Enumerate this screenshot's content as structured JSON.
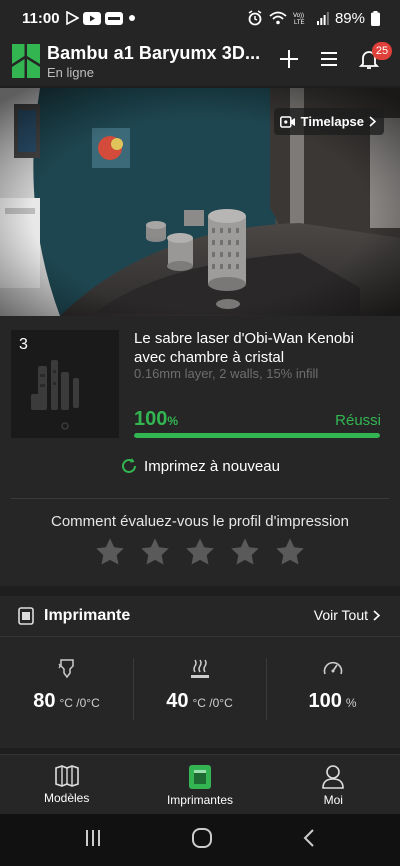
{
  "status_bar": {
    "time": "11:00",
    "app_icons": [
      "play-store-icon",
      "youtube-icon",
      "bbc-app-icon",
      "dot-icon"
    ],
    "status_icons": [
      "alarm-icon",
      "wifi-icon",
      "volte-lte-icon",
      "signal-icon"
    ],
    "volte": "VoLTE",
    "battery": "89%"
  },
  "header": {
    "title": "Bambu a1 Baryumx 3D...",
    "status": "En ligne",
    "notification_count": "25",
    "brand_color": "#33b652"
  },
  "camera": {
    "timelapse_label": "Timelapse"
  },
  "job": {
    "plate_number": "3",
    "name": "Le sabre laser d'Obi-Wan Kenobi avec chambre à cristal",
    "meta": "0.16mm layer, 2 walls, 15% infill",
    "progress_value": "100",
    "progress_unit": "%",
    "progress_fraction": 1.0,
    "state": "Réussi",
    "reprint_label": "Imprimez à nouveau",
    "rating_title": "Comment évaluez-vous le profil d'impression",
    "rating_stars": 5,
    "rating_value": 0
  },
  "printer": {
    "title": "Imprimante",
    "see_all": "Voir Tout",
    "stats": [
      {
        "icon": "nozzle-icon",
        "value": "80",
        "unit": "°C /0°C"
      },
      {
        "icon": "heatbed-icon",
        "value": "40",
        "unit": "°C /0°C"
      },
      {
        "icon": "speed-gauge-icon",
        "value": "100",
        "unit": "%"
      }
    ]
  },
  "bottom_nav": [
    {
      "label": "Modèles",
      "icon": "models-icon",
      "active": false
    },
    {
      "label": "Imprimantes",
      "icon": "printer-icon",
      "active": true
    },
    {
      "label": "Moi",
      "icon": "profile-icon",
      "active": false
    }
  ]
}
